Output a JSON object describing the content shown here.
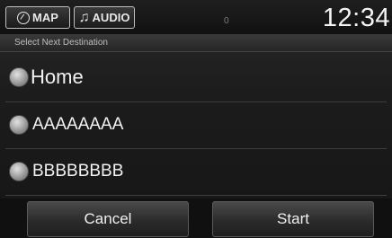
{
  "topbar": {
    "map_label": "MAP",
    "audio_label": "AUDIO",
    "indicator": "0",
    "clock": "12:34"
  },
  "header": {
    "title": "Select Next Destination"
  },
  "destinations": [
    {
      "label": "Home"
    },
    {
      "label": "AAAAAAAA"
    },
    {
      "label": "BBBBBBBB"
    }
  ],
  "footer": {
    "cancel_label": "Cancel",
    "start_label": "Start"
  },
  "icons": {
    "map": "compass-icon",
    "audio": "music-note-icon",
    "option": "radio-button-icon"
  }
}
